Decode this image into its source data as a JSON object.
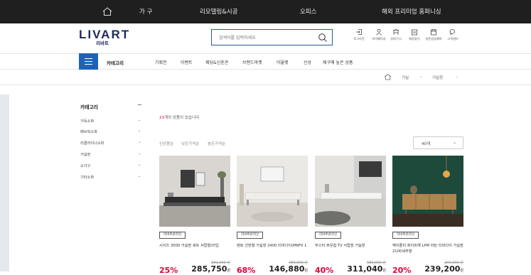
{
  "topnav": {
    "home_icon": "home-icon",
    "items": [
      "가 구",
      "리모델링&시공",
      "오피스",
      "해외 프리미엄 홈퍼니싱"
    ]
  },
  "header": {
    "logo_main": "LIVART",
    "logo_sub": "리바트",
    "search_placeholder": "검색어를 입력하세요",
    "utils": [
      {
        "icon": "login-icon",
        "label": "로그아웃"
      },
      {
        "icon": "person-icon",
        "label": "마이페이지"
      },
      {
        "icon": "cart-icon",
        "label": "장바구니"
      },
      {
        "icon": "store-icon",
        "label": "매장찾기"
      },
      {
        "icon": "calendar-icon",
        "label": "방문상담예약"
      },
      {
        "icon": "chat-icon",
        "label": "고객센터"
      }
    ]
  },
  "catbar": {
    "category_label": "카테고리",
    "menu": [
      "기획전",
      "이벤트",
      "웨딩&신혼관",
      "브랜드마켓",
      "아울렛",
      "신상",
      "제구매 높은 상품"
    ]
  },
  "breadcrumb": {
    "home_icon": "home-icon",
    "level1": "거실",
    "level2": "거실장"
  },
  "sidebar": {
    "title": "카테고리",
    "toggle": "−",
    "items": [
      "거독소파",
      "패브릭소파",
      "리클라이너소파",
      "거실장",
      "소가구",
      "기타소파"
    ]
  },
  "listing": {
    "count_num": "23",
    "count_text": "개의 상품이 있습니다.",
    "sort_options": [
      "신상품순",
      "낮은가격순",
      "높은가격순"
    ],
    "per_page": "40개"
  },
  "products": [
    {
      "badge": "리바트온라인",
      "name": "시이즈 3000 거실장 세트 서랍형(타입",
      "orig": "381,000 원",
      "discount": "25%",
      "price": "285,750",
      "unit": "원",
      "image_icon": "living-room-dark-tv-stand-image"
    },
    {
      "badge": "리바트온라인",
      "name": "렌토 선반형 거실장 2400 티비다이(MRF0 1",
      "orig": "489,000 원",
      "discount": "68%",
      "price": "146,880",
      "unit": "원",
      "image_icon": "living-room-white-tv-stand-image"
    },
    {
      "badge": "리바트온라인",
      "name": "부스터 뷰유칩 TV 서랍장 거실장",
      "orig": "689,000 원",
      "discount": "40%",
      "price": "311,040",
      "unit": "원",
      "image_icon": "living-room-long-white-stand-image"
    },
    {
      "badge": "리바트온라인",
      "name": "헤이즐리 화이트헤 LPM 라탄 티비다이 거실장 2100세주형",
      "orig": "299,000 원",
      "discount": "20%",
      "price": "239,200",
      "unit": "원",
      "image_icon": "living-room-green-wall-cabinet-image"
    }
  ]
}
